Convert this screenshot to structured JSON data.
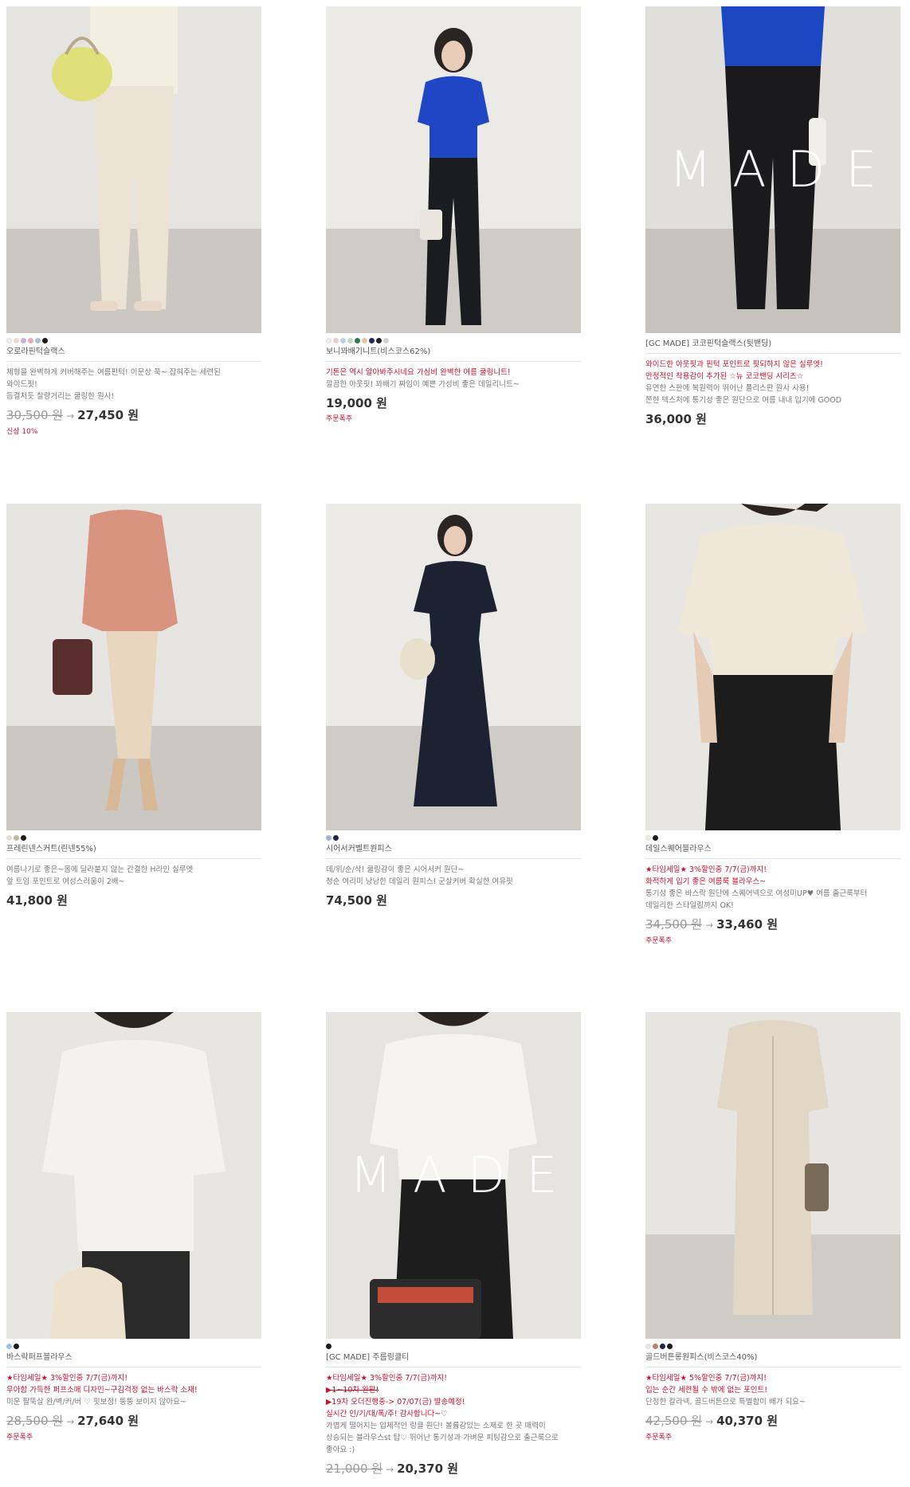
{
  "products": [
    {
      "swatches": [
        "#f3f0e8",
        "#e9dcc8",
        "#c8b0d6",
        "#e8a9b9",
        "#a9bde0",
        "#1b1b1b"
      ],
      "name": "오로라핀턱슬랙스",
      "desc": [
        {
          "text": "체형을 완벽하게 커버해주는 여름핀턱! 이문상 쭉~ 잡혀주는 세련된",
          "red": false
        },
        {
          "text": "와이드핏!",
          "red": false
        },
        {
          "text": "듬결처듯 찰랑거리는 쿨링한 원사!",
          "red": false
        }
      ],
      "orig": "30,500 원",
      "arrow": "→",
      "price": "27,450 원",
      "tag": "신상 10%"
    },
    {
      "swatches": [
        "#f4efe6",
        "#e8cfc6",
        "#b9d1e4",
        "#c7d4c4",
        "#2f7a4a",
        "#e0c9a0",
        "#1e2b59",
        "#222222",
        "#cfcfcf"
      ],
      "name": "보니꽈배기니트(비스코스62%)",
      "desc": [
        {
          "text": "기톤은 역시 알아봐주시네요 가심비 완벽한 여름 쿨링니트!",
          "red": true
        },
        {
          "text": "깔끔한 아웃핏! 꽈배기 짜임이 예쁜 가성비 좋은 데일리니트~",
          "red": false
        }
      ],
      "orig": "",
      "arrow": "",
      "price": "19,000 원",
      "tag": "주문폭주"
    },
    {
      "swatches": [],
      "name": "[GC MADE] 코코핀턱슬랙스(뒷밴딩)",
      "desc": [
        {
          "text": "와이드한 아웃핏과 핀턱 포인트로 핏되하지 않은 실루엣!",
          "red": true
        },
        {
          "text": "안정적인 착용감이 추가된 ☆뉴 코코밴딩 시리즈☆",
          "red": true
        },
        {
          "text": "유연한 스판에 복원력이 뛰어난 폴리스판 원사 사용!",
          "red": false
        },
        {
          "text": "쫀한 텍스처에 통기성 좋은 원단으로 여름 내내 입기에 GOOD",
          "red": false
        }
      ],
      "orig": "",
      "arrow": "",
      "price": "36,000 원",
      "tag": "",
      "made": "MADE"
    },
    {
      "swatches": [
        "#e9dcc8",
        "#c9b59b",
        "#1b1b1b"
      ],
      "name": "프레린넨스커트(린넨55%)",
      "desc": [
        {
          "text": "여름나기로 좋은~몸에 달라붙지 않는 간결한 H라인 실루엣",
          "red": false
        },
        {
          "text": "앞 트임 포인트로 여성스러움이 2배~",
          "red": false
        }
      ],
      "orig": "",
      "arrow": "",
      "price": "41,800 원",
      "tag": ""
    },
    {
      "swatches": [
        "#9fb5d1",
        "#1e2a44"
      ],
      "name": "시어서커벨트원피스",
      "desc": [
        {
          "text": "데/위/순/삭! 쿨링감이 좋은 시어서커 원단~",
          "red": false
        },
        {
          "text": "청순 여리미 낭낭한 데일리 원피스! 군살커버 확실한 여유핏",
          "red": false
        }
      ],
      "orig": "",
      "arrow": "",
      "price": "74,500 원",
      "tag": ""
    },
    {
      "swatches": [
        "#f3ede0",
        "#1b1b1b"
      ],
      "name": "데일스퀘어블라우스",
      "desc": [
        {
          "text": "★타임세일★ 3%할인중 7/7(금)까지!",
          "red": true
        },
        {
          "text": "화적하게 입기 좋은 여름룩 블라우스~",
          "red": true
        },
        {
          "text": "통기성 좋은 바스락 원단에 스퀘어넥으로 여성미UP♥ 여름 출근룩부터",
          "red": false
        },
        {
          "text": "데일리한 스타일링까지 OK!",
          "red": false
        }
      ],
      "orig": "34,500 원",
      "arrow": "→",
      "price": "33,460 원",
      "tag": "주문폭주"
    },
    {
      "swatches": [
        "#9fc3dc",
        "#1b1b1b"
      ],
      "name": "바스락퍼프블라우스",
      "desc": [
        {
          "text": "★타임세일★ 3%할인중 7/7(금)까지!",
          "red": true
        },
        {
          "text": "우아함 가득한 퍼프소매 디자인~구김걱정 없는 바스락 소재!",
          "red": true
        },
        {
          "text": "미운 팔뚝살 완/벽/커/버 ♡ 핏보정! 뚱뚱 보이지 않아요~",
          "red": false
        }
      ],
      "orig": "28,500 원",
      "arrow": "→",
      "price": "27,640 원",
      "tag": "주문폭주"
    },
    {
      "swatches": [
        "#1b1b1b"
      ],
      "name": "[GC MADE] 주름링클티",
      "desc": [
        {
          "text": "★타임세일★ 3%할인중 7/7(금)까지!",
          "red": true
        },
        {
          "text": "▶1~10차 완판!",
          "red": true,
          "strike": true
        },
        {
          "text": "▶19차 오더진행중-> 07/07(금) 발송예정!",
          "red": true
        },
        {
          "text": "실시간 인/기/대/폭/주! 감사합니다~♡",
          "red": true
        },
        {
          "text": "가볍게 떨어지는 입체적인 링클 원단! 볼륨감있는 소재로 한 곳 매력이",
          "red": false
        },
        {
          "text": "상승되는 블라우스st 탑♡ 뛰어난 통기성과 가벼운 피팅감으로 출근룩으로",
          "red": false
        },
        {
          "text": "좋아요 :)",
          "red": false
        }
      ],
      "orig": "21,000 원",
      "arrow": "→",
      "price": "20,370 원",
      "tag": "",
      "made": "MADE"
    },
    {
      "swatches": [
        "#efe7dc",
        "#b5866a",
        "#1e2a44",
        "#1b1b1b"
      ],
      "name": "골드버튼롱원피스(비스코스40%)",
      "desc": [
        {
          "text": "★타임세일★ 5%할인중 7/7(금)까지!",
          "red": true
        },
        {
          "text": "입는 순간 세련될 수 밖에 없는 포인트!",
          "red": true
        },
        {
          "text": "단정한 칼라넥, 골드버튼으로 특별함이 배가 되요~",
          "red": false
        }
      ],
      "orig": "42,500 원",
      "arrow": "→",
      "price": "40,370 원",
      "tag": "주문폭주"
    }
  ]
}
